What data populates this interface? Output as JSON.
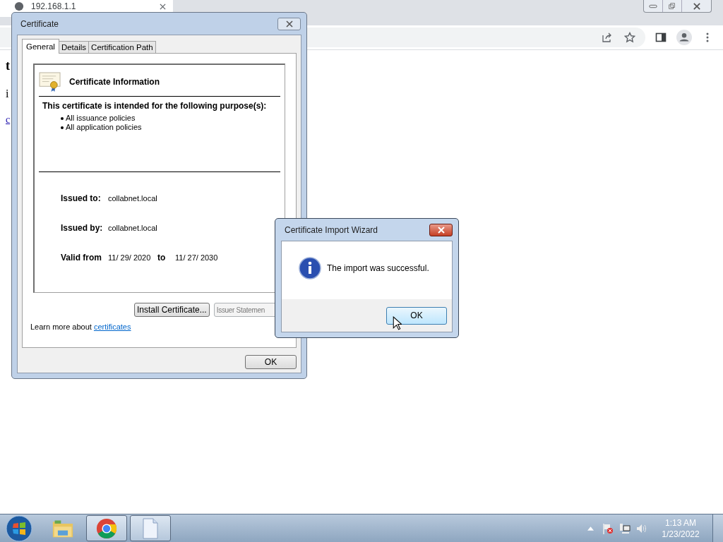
{
  "browser": {
    "tab_title": "192.168.1.1",
    "page_text": [
      {
        "text": "t",
        "kind": "heading"
      },
      {
        "text": "i",
        "kind": "paragraph"
      },
      {
        "text": "c",
        "kind": "link"
      }
    ]
  },
  "certificate_dialog": {
    "title": "Certificate",
    "tabs": [
      {
        "label": "General",
        "selected": true
      },
      {
        "label": "Details",
        "selected": false
      },
      {
        "label": "Certification Path",
        "selected": false
      }
    ],
    "header": "Certificate Information",
    "purpose_heading": "This certificate is intended for the following purpose(s):",
    "purposes": [
      "All issuance policies",
      "All application policies"
    ],
    "issued_to": {
      "label": "Issued to:",
      "value": "collabnet.local"
    },
    "issued_by": {
      "label": "Issued by:",
      "value": "collabnet.local"
    },
    "validity": {
      "label": "Valid from",
      "from": "11/ 29/ 2020",
      "to_label": "to",
      "to": "11/ 27/ 2030"
    },
    "buttons": [
      {
        "label": "Install Certificate...",
        "disabled": false
      },
      {
        "label": "Issuer Statemen",
        "disabled": true
      }
    ],
    "learn_more": {
      "text": "Learn more about",
      "link": "certificates"
    },
    "ok_button": "OK"
  },
  "wizard_dialog": {
    "title": "Certificate Import Wizard",
    "message": "The import was successful.",
    "ok_button": "OK"
  },
  "taskbar": {
    "items": [
      {
        "kind": "explorer",
        "active": false
      },
      {
        "kind": "chrome",
        "active": true
      },
      {
        "kind": "document",
        "active": true
      }
    ],
    "clock": {
      "time": "1:13 AM",
      "date": "1/23/2022"
    }
  }
}
